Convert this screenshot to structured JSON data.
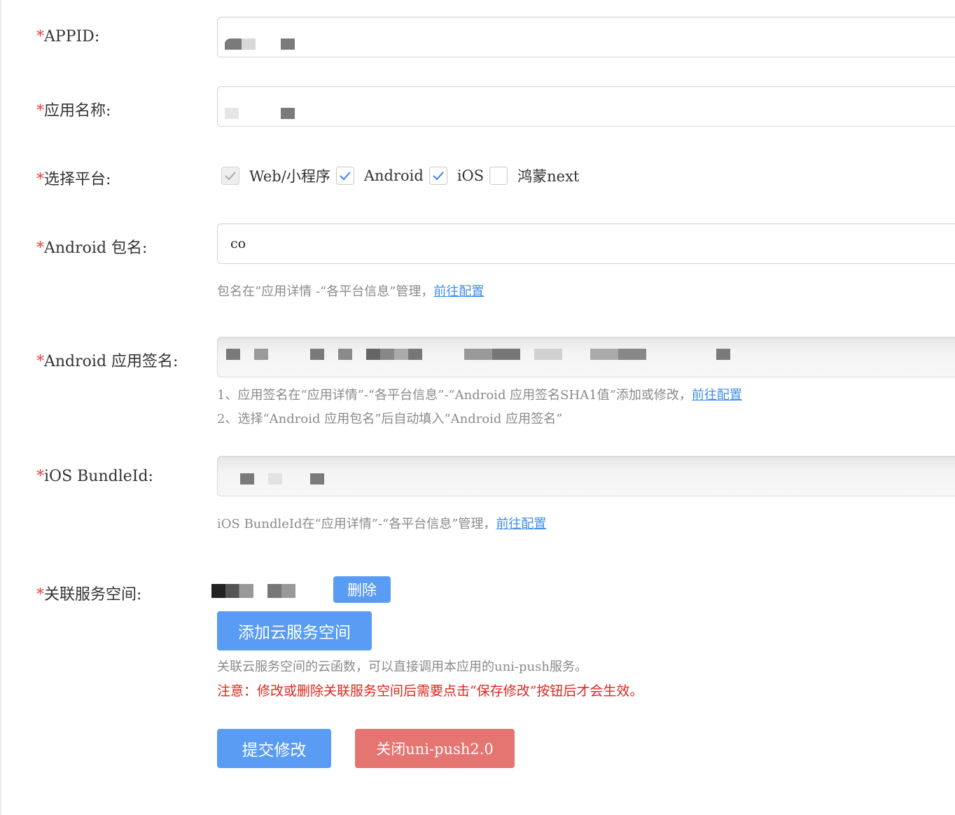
{
  "form": {
    "required_mark": "*",
    "appid": {
      "label": "APPID:",
      "value": ""
    },
    "app_name": {
      "label": "应用名称:",
      "value": ""
    },
    "platforms": {
      "label": "选择平台:",
      "options": [
        {
          "label": "Web/小程序",
          "checked": true,
          "disabled": true
        },
        {
          "label": "Android",
          "checked": true,
          "disabled": false
        },
        {
          "label": "iOS",
          "checked": true,
          "disabled": false
        },
        {
          "label": "鸿蒙next",
          "checked": false,
          "disabled": false
        }
      ]
    },
    "android_package": {
      "label": "Android 包名:",
      "value": "co",
      "hint": "包名在“应用详情 -“各平台信息”管理，",
      "hint_link": "前往配置"
    },
    "android_signature": {
      "label": "Android 应用签名:",
      "value": "",
      "hint1": "1、应用签名在“应用详情”-“各平台信息”-“Android 应用签名SHA1值”添加或修改，",
      "hint1_link": "前往配置",
      "hint2": "2、选择“Android 应用包名”后自动填入“Android 应用签名”"
    },
    "ios_bundle": {
      "label": "iOS BundleId:",
      "value": "",
      "hint": "iOS BundleId在“应用详情”-“各平台信息”管理，",
      "hint_link": "前往配置"
    },
    "service_space": {
      "label": "关联服务空间:",
      "delete_label": "删除",
      "add_label": "添加云服务空间",
      "hint": "关联云服务空间的云函数，可以直接调用本应用的uni-push服务。",
      "warning": "注意：修改或删除关联服务空间后需要点击“保存修改”按钮后才会生效。"
    }
  },
  "actions": {
    "submit_label": "提交修改",
    "close_label": "关闭uni-push2.0"
  },
  "colors": {
    "primary": "#5a9cf3",
    "danger": "#e57571",
    "required": "#e23c3c",
    "warning_text": "#e0251d",
    "link": "#3f8ee8"
  }
}
